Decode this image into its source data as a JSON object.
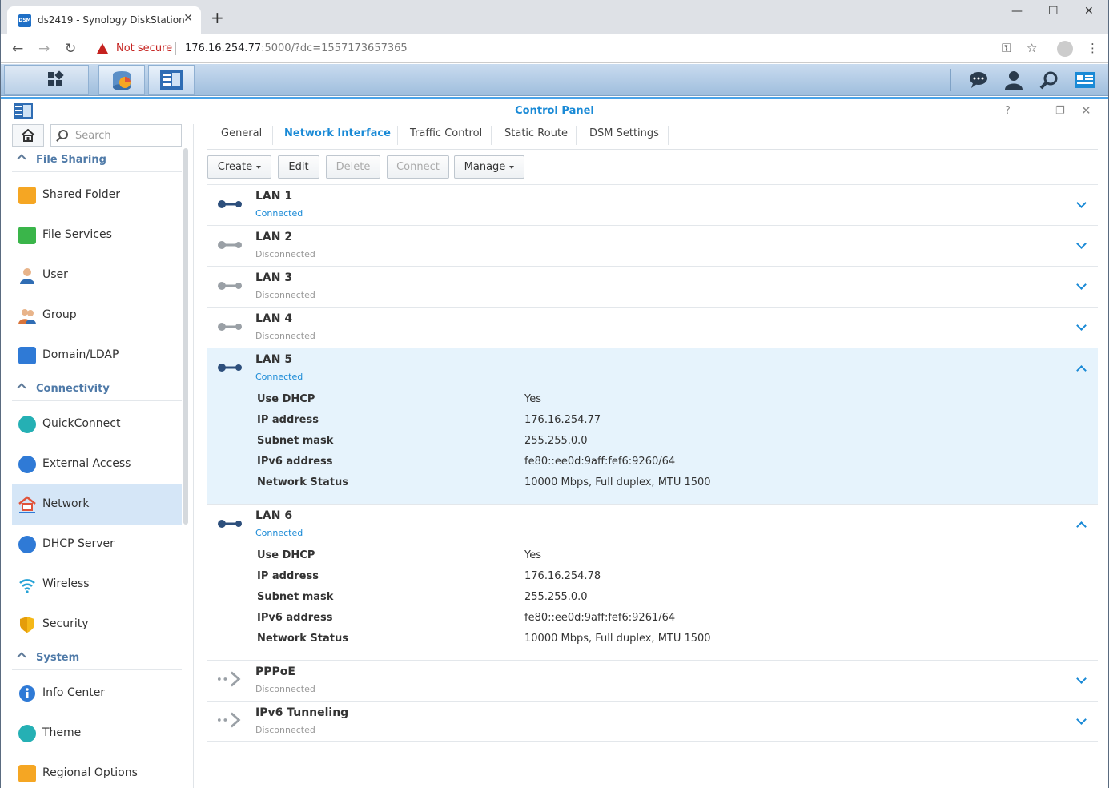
{
  "browser": {
    "tab_title": "ds2419 - Synology DiskStation",
    "favicon_text": "DSM",
    "not_secure": "Not secure",
    "url_host": "176.16.254.77",
    "url_rest": ":5000/?dc=1557173657365"
  },
  "window": {
    "title": "Control Panel"
  },
  "search": {
    "placeholder": "Search"
  },
  "sidebar": {
    "sections": [
      {
        "label": "File Sharing"
      },
      {
        "label": "Connectivity"
      },
      {
        "label": "System"
      }
    ],
    "items": [
      {
        "label": "Shared Folder",
        "icon": "shared-folder-icon",
        "color": "#f5a623"
      },
      {
        "label": "File Services",
        "icon": "file-services-icon",
        "color": "#3ab54a"
      },
      {
        "label": "User",
        "icon": "user-icon",
        "color": "#2f6db4"
      },
      {
        "label": "Group",
        "icon": "group-icon",
        "color": "#d9743a"
      },
      {
        "label": "Domain/LDAP",
        "icon": "domain-ldap-icon",
        "color": "#2f7ad6"
      },
      {
        "label": "QuickConnect",
        "icon": "quickconnect-icon",
        "color": "#25b0b4"
      },
      {
        "label": "External Access",
        "icon": "external-access-icon",
        "color": "#2f7ad6"
      },
      {
        "label": "Network",
        "icon": "network-icon",
        "color": "#e0533a"
      },
      {
        "label": "DHCP Server",
        "icon": "dhcp-server-icon",
        "color": "#2f7ad6"
      },
      {
        "label": "Wireless",
        "icon": "wireless-icon",
        "color": "#25a2d6"
      },
      {
        "label": "Security",
        "icon": "security-icon",
        "color": "#f5b818"
      },
      {
        "label": "Info Center",
        "icon": "info-center-icon",
        "color": "#2f7ad6"
      },
      {
        "label": "Theme",
        "icon": "theme-icon",
        "color": "#25b0b4"
      },
      {
        "label": "Regional Options",
        "icon": "regional-options-icon",
        "color": "#f5a623"
      }
    ]
  },
  "tabs": [
    "General",
    "Network Interface",
    "Traffic Control",
    "Static Route",
    "DSM Settings"
  ],
  "toolbar": {
    "create": "Create",
    "edit": "Edit",
    "delete": "Delete",
    "connect": "Connect",
    "manage": "Manage"
  },
  "detail_labels": {
    "dhcp": "Use DHCP",
    "ip": "IP address",
    "mask": "Subnet mask",
    "ipv6": "IPv6 address",
    "status": "Network Status"
  },
  "interfaces": [
    {
      "name": "LAN 1",
      "status": "Connected"
    },
    {
      "name": "LAN 2",
      "status": "Disconnected"
    },
    {
      "name": "LAN 3",
      "status": "Disconnected"
    },
    {
      "name": "LAN 4",
      "status": "Disconnected"
    },
    {
      "name": "LAN 5",
      "status": "Connected",
      "dhcp": "Yes",
      "ip": "176.16.254.77",
      "mask": "255.255.0.0",
      "ipv6": "fe80::ee0d:9aff:fef6:9260/64",
      "net_status": "10000 Mbps, Full duplex, MTU 1500"
    },
    {
      "name": "LAN 6",
      "status": "Connected",
      "dhcp": "Yes",
      "ip": "176.16.254.78",
      "mask": "255.255.0.0",
      "ipv6": "fe80::ee0d:9aff:fef6:9261/64",
      "net_status": "10000 Mbps, Full duplex, MTU 1500"
    },
    {
      "name": "PPPoE",
      "status": "Disconnected"
    },
    {
      "name": "IPv6 Tunneling",
      "status": "Disconnected"
    }
  ],
  "colors": {
    "accent": "#1a8ad6",
    "connected_icon": "#2d4f7c",
    "disconnected_icon": "#9aa0a6"
  }
}
